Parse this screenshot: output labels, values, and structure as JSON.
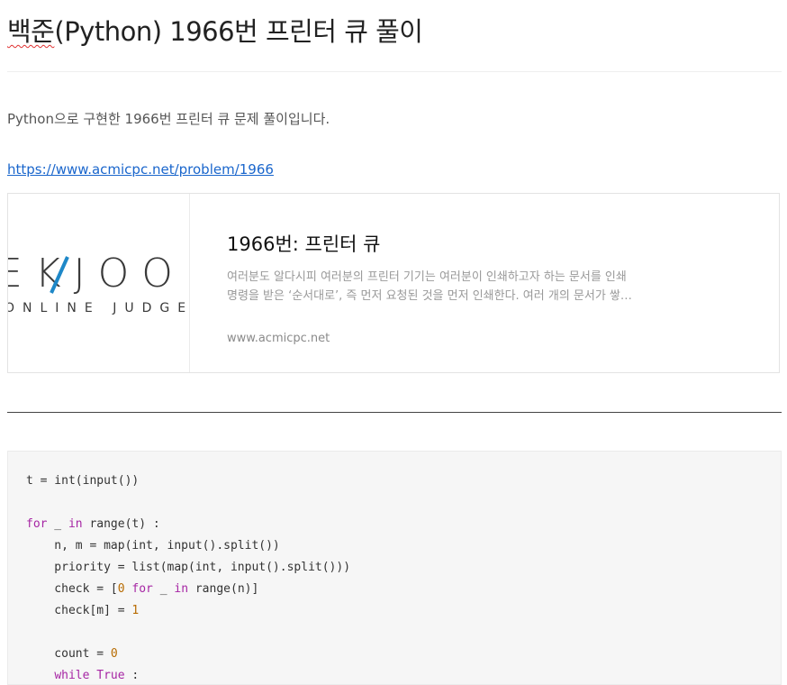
{
  "post": {
    "title_spell": "백준",
    "title_rest": "(Python) 1966번 프린터 큐 풀이",
    "intro": "Python으로 구현한 1966번 프린터 큐 문제 풀이입니다.",
    "link_text": "https://www.acmicpc.net/problem/1966"
  },
  "og_card": {
    "logo_top": "EKJOO",
    "logo_bottom": "ONLINE JUDGE",
    "logo_accent": "#1e88c8",
    "title": "1966번: 프린터 큐",
    "desc_line1": "여러분도 알다시피 여러분의 프린터 기기는 여러분이 인쇄하고자 하는 문서를 인쇄",
    "desc_line2": "명령을 받은 ‘순서대로’, 즉 먼저 요청된 것을 먼저 인쇄한다. 여러 개의 문서가 쌓…",
    "host": "www.acmicpc.net"
  },
  "code": {
    "lines": [
      {
        "text": "t = int(input())"
      },
      {
        "text": ""
      },
      {
        "html": "<span class=\"kw\">for</span> _ <span class=\"kw\">in</span> range(t) :"
      },
      {
        "text": "    n, m = map(int, input().split())"
      },
      {
        "text": "    priority = list(map(int, input().split()))"
      },
      {
        "html": "    check = [<span class=\"num\">0</span> <span class=\"kw\">for</span> _ <span class=\"kw\">in</span> range(n)]"
      },
      {
        "html": "    check[m] = <span class=\"num\">1</span>"
      },
      {
        "text": ""
      },
      {
        "html": "    count = <span class=\"num\">0</span>"
      },
      {
        "html": "    <span class=\"kw\">while</span> <span class=\"kw\">True</span> :"
      }
    ]
  }
}
